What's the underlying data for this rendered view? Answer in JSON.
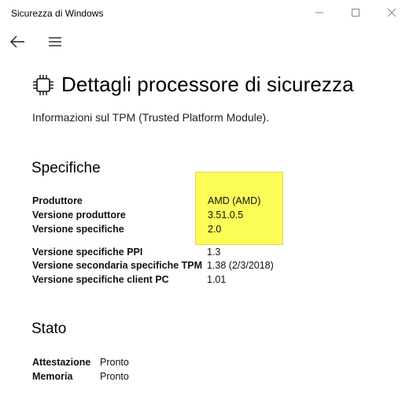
{
  "window": {
    "title": "Sicurezza di Windows"
  },
  "page": {
    "title": "Dettagli processore di sicurezza",
    "subtitle": "Informazioni sul TPM (Trusted Platform Module)."
  },
  "specifiche": {
    "heading": "Specifiche",
    "rows": [
      {
        "label": "Produttore",
        "value": "AMD (AMD)"
      },
      {
        "label": "Versione produttore",
        "value": "3.51.0.5"
      },
      {
        "label": "Versione specifiche",
        "value": "2.0"
      },
      {
        "label": "Versione specifiche PPI",
        "value": "1.3"
      },
      {
        "label": "Versione secondaria specifiche TPM",
        "value": "1.38 (2/3/2018)"
      },
      {
        "label": "Versione specifiche client PC",
        "value": "1.01"
      }
    ]
  },
  "stato": {
    "heading": "Stato",
    "rows": [
      {
        "label": "Attestazione",
        "value": "Pronto"
      },
      {
        "label": "Memoria",
        "value": "Pronto"
      }
    ]
  },
  "highlight_color": "#fdfd58",
  "icons": [
    "minimize-icon",
    "maximize-icon",
    "close-icon",
    "back-arrow-icon",
    "hamburger-menu-icon",
    "processor-chip-icon"
  ]
}
